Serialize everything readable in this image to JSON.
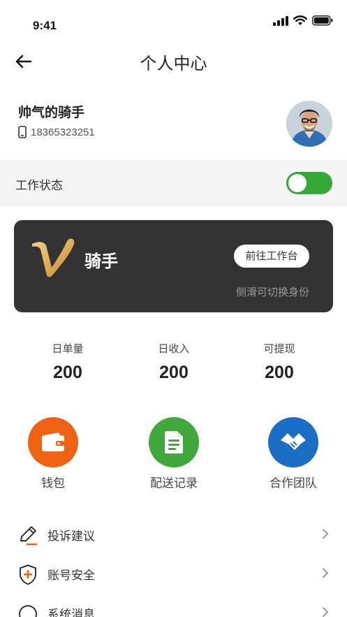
{
  "status_bar": {
    "time": "9:41"
  },
  "nav": {
    "title": "个人中心"
  },
  "profile": {
    "name": "帅气的骑手",
    "phone": "18365323251"
  },
  "work_status": {
    "label": "工作状态",
    "enabled": true
  },
  "role_card": {
    "logo_letter": "V",
    "role": "骑手",
    "workbench_button": "前往工作台",
    "hint": "侧滑可切换身份"
  },
  "stats": [
    {
      "label": "日单量",
      "value": "200"
    },
    {
      "label": "日收入",
      "value": "200"
    },
    {
      "label": "可提现",
      "value": "200"
    }
  ],
  "quick_actions": [
    {
      "label": "钱包",
      "icon": "wallet-icon",
      "color": "#ee6211"
    },
    {
      "label": "配送记录",
      "icon": "document-icon",
      "color": "#3fa83a"
    },
    {
      "label": "合作团队",
      "icon": "handshake-icon",
      "color": "#1a6fc4"
    }
  ],
  "menu": [
    {
      "label": "投诉建议",
      "icon": "pen-icon"
    },
    {
      "label": "账号安全",
      "icon": "shield-icon"
    },
    {
      "label": "系统消息",
      "icon": "message-icon"
    }
  ],
  "colors": {
    "toggle_on": "#36a838",
    "card_bg": "#333333",
    "accent_orange": "#ee6211"
  }
}
